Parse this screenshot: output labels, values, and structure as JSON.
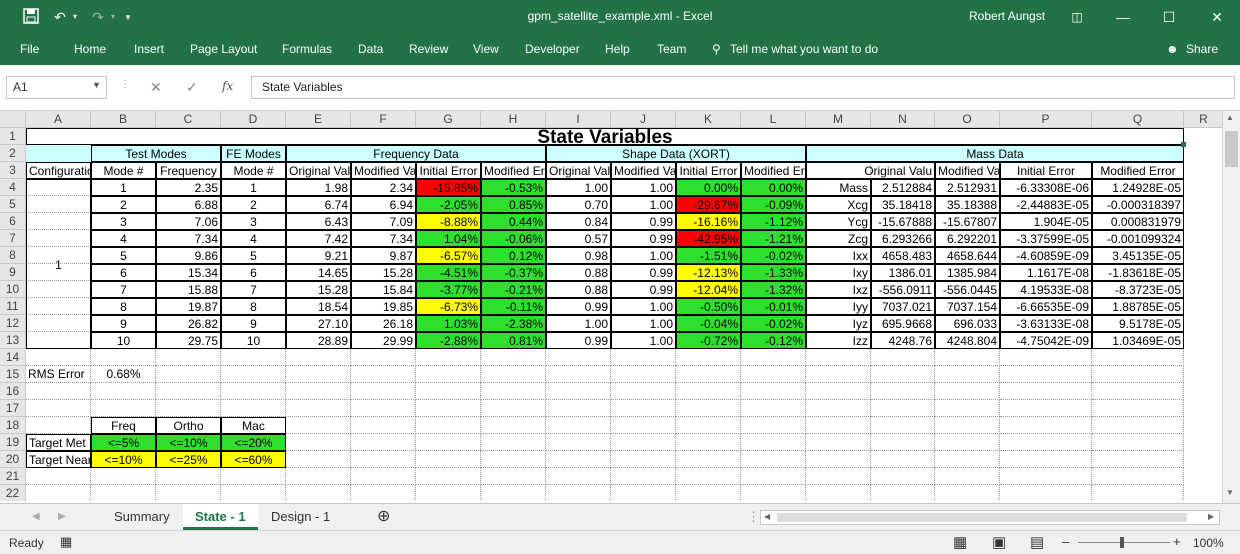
{
  "window": {
    "title": "gpm_satellite_example.xml  -  Excel",
    "user": "Robert Aungst"
  },
  "ribbon": {
    "tabs": [
      "File",
      "Home",
      "Insert",
      "Page Layout",
      "Formulas",
      "Data",
      "Review",
      "View",
      "Developer",
      "Help",
      "Team"
    ],
    "tell_me": "Tell me what you want to do",
    "share": "Share"
  },
  "formula_bar": {
    "name_box": "A1",
    "fx": "fx",
    "content": "State Variables"
  },
  "columns": [
    "A",
    "B",
    "C",
    "D",
    "E",
    "F",
    "G",
    "H",
    "I",
    "J",
    "K",
    "L",
    "M",
    "N",
    "O",
    "P",
    "Q",
    "R"
  ],
  "rows": [
    "1",
    "2",
    "3",
    "4",
    "5",
    "6",
    "7",
    "8",
    "9",
    "10",
    "11",
    "12",
    "13",
    "14",
    "15",
    "16",
    "17",
    "18",
    "19",
    "20",
    "21",
    "22"
  ],
  "sheet": {
    "title": "State Variables",
    "groups": {
      "test_modes": "Test Modes",
      "fe_modes": "FE Modes",
      "frequency_data": "Frequency Data",
      "shape_data": "Shape Data (XORT)",
      "mass_data": "Mass Data"
    },
    "headers": {
      "configuration": "Configuratio",
      "mode_num": "Mode #",
      "frequency": "Frequency",
      "fe_mode_num": "Mode #",
      "f_orig": "Original Valu",
      "f_mod": "Modified Valu",
      "f_init_err": "Initial Error",
      "f_mod_err": "Modified Erro",
      "s_orig": "Original Valu",
      "s_mod": "Modified Valu",
      "s_init_err": "Initial Error",
      "s_mod_err": "Modified Error",
      "m_orig": "Original Valu",
      "m_mod": "Modified Valu",
      "m_init_err": "Initial Error",
      "m_mod_err": "Modified Error"
    },
    "configuration_value": "1",
    "rows": [
      {
        "mode": "1",
        "freq": "2.35",
        "fe": "1",
        "fo": "1.98",
        "fm": "2.34",
        "fie": "-15.85%",
        "fie_c": "rd",
        "fme": "-0.53%",
        "fme_c": "g",
        "so": "1.00",
        "sm": "1.00",
        "sie": "0.00%",
        "sie_c": "g",
        "sme": "0.00%",
        "sme_c": "g",
        "mlabel": "Mass",
        "mo": "2.512884",
        "mm": "2.512931",
        "mie": "-6.33308E-06",
        "mme": "1.24928E-05"
      },
      {
        "mode": "2",
        "freq": "6.88",
        "fe": "2",
        "fo": "6.74",
        "fm": "6.94",
        "fie": "-2.05%",
        "fie_c": "g",
        "fme": "0.85%",
        "fme_c": "g",
        "so": "0.70",
        "sm": "1.00",
        "sie": "-29.67%",
        "sie_c": "rd",
        "sme": "-0.09%",
        "sme_c": "g",
        "mlabel": "Xcg",
        "mo": "35.18418",
        "mm": "35.18388",
        "mie": "-2.44883E-05",
        "mme": "-0.000318397"
      },
      {
        "mode": "3",
        "freq": "7.06",
        "fe": "3",
        "fo": "6.43",
        "fm": "7.09",
        "fie": "-8.88%",
        "fie_c": "y",
        "fme": "0.44%",
        "fme_c": "g",
        "so": "0.84",
        "sm": "0.99",
        "sie": "-16.16%",
        "sie_c": "y",
        "sme": "-1.12%",
        "sme_c": "g",
        "mlabel": "Ycg",
        "mo": "-15.67888",
        "mm": "-15.67807",
        "mie": "1.904E-05",
        "mme": "0.000831979"
      },
      {
        "mode": "4",
        "freq": "7.34",
        "fe": "4",
        "fo": "7.42",
        "fm": "7.34",
        "fie": "1.04%",
        "fie_c": "g",
        "fme": "-0.06%",
        "fme_c": "g",
        "so": "0.57",
        "sm": "0.99",
        "sie": "-42.95%",
        "sie_c": "rd",
        "sme": "-1.21%",
        "sme_c": "g",
        "mlabel": "Zcg",
        "mo": "6.293266",
        "mm": "6.292201",
        "mie": "-3.37599E-05",
        "mme": "-0.001099324"
      },
      {
        "mode": "5",
        "freq": "9.86",
        "fe": "5",
        "fo": "9.21",
        "fm": "9.87",
        "fie": "-6.57%",
        "fie_c": "y",
        "fme": "0.12%",
        "fme_c": "g",
        "so": "0.98",
        "sm": "1.00",
        "sie": "-1.51%",
        "sie_c": "g",
        "sme": "-0.02%",
        "sme_c": "g",
        "mlabel": "Ixx",
        "mo": "4658.483",
        "mm": "4658.644",
        "mie": "-4.60859E-09",
        "mme": "3.45135E-05"
      },
      {
        "mode": "6",
        "freq": "15.34",
        "fe": "6",
        "fo": "14.65",
        "fm": "15.28",
        "fie": "-4.51%",
        "fie_c": "g",
        "fme": "-0.37%",
        "fme_c": "g",
        "so": "0.88",
        "sm": "0.99",
        "sie": "-12.13%",
        "sie_c": "y",
        "sme": "-1.33%",
        "sme_c": "g",
        "mlabel": "Ixy",
        "mo": "1386.01",
        "mm": "1385.984",
        "mie": "1.1617E-08",
        "mme": "-1.83618E-05"
      },
      {
        "mode": "7",
        "freq": "15.88",
        "fe": "7",
        "fo": "15.28",
        "fm": "15.84",
        "fie": "-3.77%",
        "fie_c": "g",
        "fme": "-0.21%",
        "fme_c": "g",
        "so": "0.88",
        "sm": "0.99",
        "sie": "-12.04%",
        "sie_c": "y",
        "sme": "-1.32%",
        "sme_c": "g",
        "mlabel": "Ixz",
        "mo": "-556.0911",
        "mm": "-556.0445",
        "mie": "4.19533E-08",
        "mme": "-8.3723E-05"
      },
      {
        "mode": "8",
        "freq": "19.87",
        "fe": "8",
        "fo": "18.54",
        "fm": "19.85",
        "fie": "-6.73%",
        "fie_c": "y",
        "fme": "-0.11%",
        "fme_c": "g",
        "so": "0.99",
        "sm": "1.00",
        "sie": "-0.50%",
        "sie_c": "g",
        "sme": "-0.01%",
        "sme_c": "g",
        "mlabel": "Iyy",
        "mo": "7037.021",
        "mm": "7037.154",
        "mie": "-6.66535E-09",
        "mme": "1.88785E-05"
      },
      {
        "mode": "9",
        "freq": "26.82",
        "fe": "9",
        "fo": "27.10",
        "fm": "26.18",
        "fie": "1.03%",
        "fie_c": "g",
        "fme": "-2.38%",
        "fme_c": "g",
        "so": "1.00",
        "sm": "1.00",
        "sie": "-0.04%",
        "sie_c": "g",
        "sme": "-0.02%",
        "sme_c": "g",
        "mlabel": "Iyz",
        "mo": "695.9668",
        "mm": "696.033",
        "mie": "-3.63133E-08",
        "mme": "9.5178E-05"
      },
      {
        "mode": "10",
        "freq": "29.75",
        "fe": "10",
        "fo": "28.89",
        "fm": "29.99",
        "fie": "-2.88%",
        "fie_c": "g",
        "fme": "0.81%",
        "fme_c": "g",
        "so": "0.99",
        "sm": "1.00",
        "sie": "-0.72%",
        "sie_c": "g",
        "sme": "-0.12%",
        "sme_c": "g",
        "mlabel": "Izz",
        "mo": "4248.76",
        "mm": "4248.804",
        "mie": "-4.75042E-09",
        "mme": "1.03469E-05"
      }
    ],
    "rms_label": "RMS Error",
    "rms_value": "0.68%",
    "targets": {
      "headers": [
        "Freq",
        "Ortho",
        "Mac"
      ],
      "met_label": "Target Met",
      "met": [
        "<=5%",
        "<=10%",
        "<=20%"
      ],
      "near_label": "Target Near",
      "near": [
        "<=10%",
        "<=25%",
        "<=60%"
      ]
    }
  },
  "sheet_tabs": [
    "Summary",
    "State - 1",
    "Design - 1"
  ],
  "active_sheet": "State - 1",
  "status": {
    "ready": "Ready",
    "zoom": "100%"
  },
  "colors": {
    "excel_green": "#217346",
    "good": "#2ee02e",
    "warn": "#ffff00",
    "bad": "#ff0000",
    "header_fill": "#ccffff"
  }
}
